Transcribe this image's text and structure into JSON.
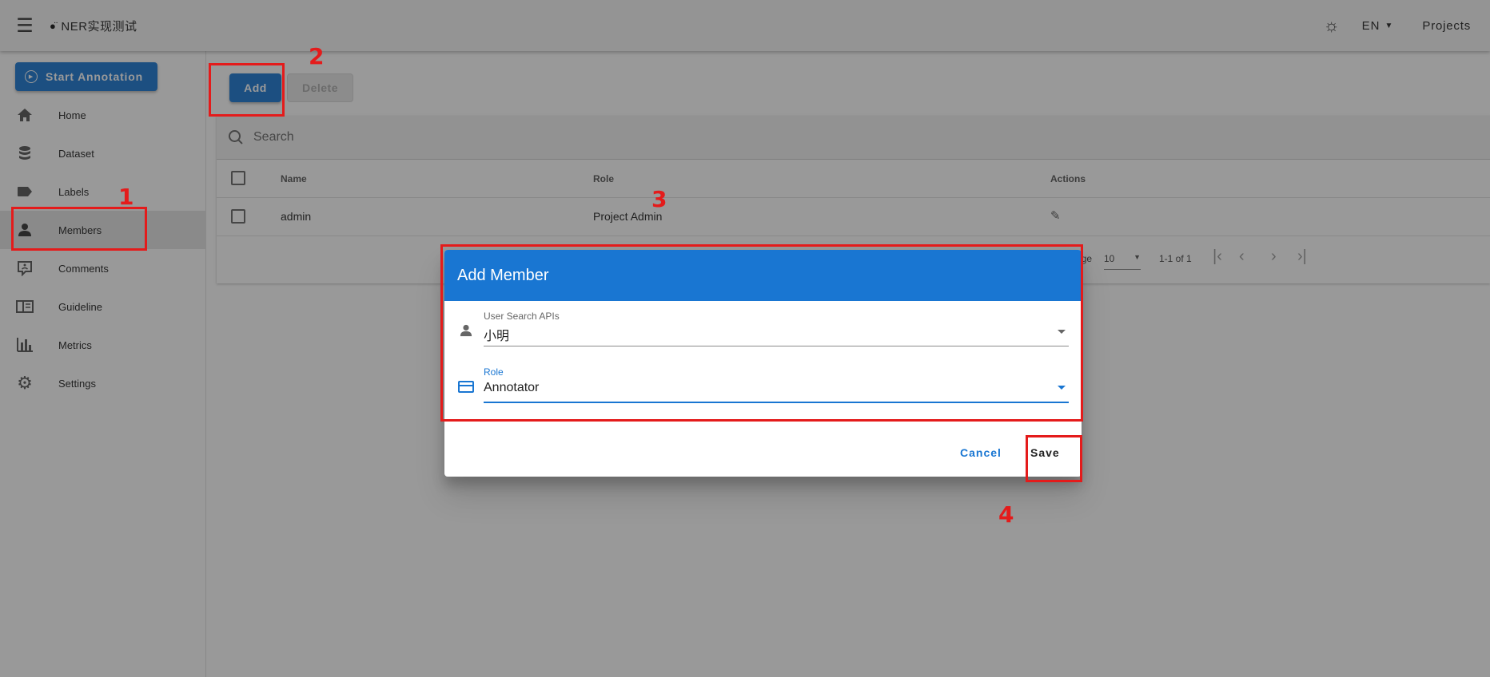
{
  "appbar": {
    "menu_icon": "menu-icon",
    "project_name": "NER实现测试",
    "theme_icon": "brightness-icon",
    "lang": "EN",
    "projects": "Projects"
  },
  "sidebar": {
    "start_annotation": "Start Annotation",
    "items": [
      {
        "label": "Home",
        "icon": "home-icon"
      },
      {
        "label": "Dataset",
        "icon": "database-icon"
      },
      {
        "label": "Labels",
        "icon": "label-icon"
      },
      {
        "label": "Members",
        "icon": "person-icon"
      },
      {
        "label": "Comments",
        "icon": "comment-icon"
      },
      {
        "label": "Guideline",
        "icon": "book-icon"
      },
      {
        "label": "Metrics",
        "icon": "chart-icon"
      },
      {
        "label": "Settings",
        "icon": "gear-icon"
      }
    ]
  },
  "toolbar": {
    "add_label": "Add",
    "delete_label": "Delete"
  },
  "search": {
    "placeholder": "Search"
  },
  "table": {
    "headers": {
      "name": "Name",
      "role": "Role",
      "actions": "Actions"
    },
    "rows": [
      {
        "name": "admin",
        "role": "Project Admin"
      }
    ],
    "footer": {
      "rows_per_page_label": "Rows per Page",
      "rows_per_page_value": "10",
      "range": "1-1 of 1"
    }
  },
  "dialog": {
    "title": "Add Member",
    "user_field": {
      "label": "User Search APIs",
      "value": "小明"
    },
    "role_field": {
      "label": "Role",
      "value": "Annotator"
    },
    "cancel": "Cancel",
    "save": "Save"
  },
  "annotations": [
    "1",
    "2",
    "3",
    "4"
  ],
  "colors": {
    "primary": "#1976d2",
    "annotation": "#e41b1b"
  }
}
